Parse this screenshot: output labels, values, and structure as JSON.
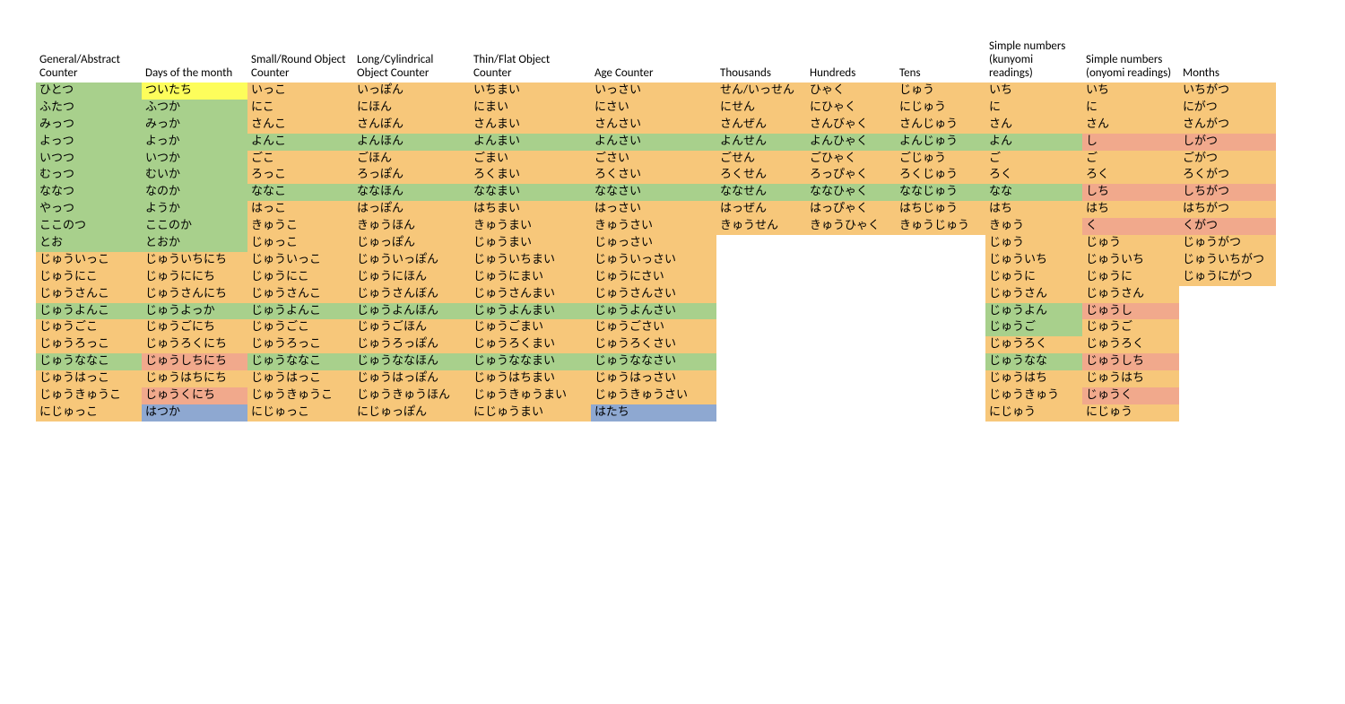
{
  "headers": [
    "General/Abstract Counter",
    "Days of the month",
    "Small/Round Object Counter",
    "Long/Cylindrical Object Counter",
    "Thin/Flat Object Counter",
    "Age Counter",
    "Thousands",
    "Hundreds",
    "Tens",
    "Simple numbers (kunyomi readings)",
    "Simple numbers (onyomi readings)",
    "Months"
  ],
  "colors": {
    "g": "c-green",
    "o": "c-orange",
    "y": "c-yellow",
    "b": "c-blue",
    "s": "c-salmon",
    "e": "c-empty"
  },
  "rows": [
    [
      {
        "t": "ひとつ",
        "c": "g"
      },
      {
        "t": "ついたち",
        "c": "y"
      },
      {
        "t": "いっこ",
        "c": "o"
      },
      {
        "t": "いっぽん",
        "c": "o"
      },
      {
        "t": "いちまい",
        "c": "o"
      },
      {
        "t": "いっさい",
        "c": "o"
      },
      {
        "t": "せん/いっせん",
        "c": "o"
      },
      {
        "t": "ひゃく",
        "c": "o"
      },
      {
        "t": "じゅう",
        "c": "o"
      },
      {
        "t": "いち",
        "c": "o"
      },
      {
        "t": "いち",
        "c": "o"
      },
      {
        "t": "いちがつ",
        "c": "o"
      }
    ],
    [
      {
        "t": "ふたつ",
        "c": "g"
      },
      {
        "t": "ふつか",
        "c": "g"
      },
      {
        "t": "にこ",
        "c": "o"
      },
      {
        "t": "にほん",
        "c": "o"
      },
      {
        "t": "にまい",
        "c": "o"
      },
      {
        "t": "にさい",
        "c": "o"
      },
      {
        "t": "にせん",
        "c": "o"
      },
      {
        "t": "にひゃく",
        "c": "o"
      },
      {
        "t": "にじゅう",
        "c": "o"
      },
      {
        "t": "に",
        "c": "o"
      },
      {
        "t": "に",
        "c": "o"
      },
      {
        "t": "にがつ",
        "c": "o"
      }
    ],
    [
      {
        "t": "みっつ",
        "c": "g"
      },
      {
        "t": "みっか",
        "c": "g"
      },
      {
        "t": "さんこ",
        "c": "o"
      },
      {
        "t": "さんぼん",
        "c": "o"
      },
      {
        "t": "さんまい",
        "c": "o"
      },
      {
        "t": "さんさい",
        "c": "o"
      },
      {
        "t": "さんぜん",
        "c": "o"
      },
      {
        "t": "さんびゃく",
        "c": "o"
      },
      {
        "t": "さんじゅう",
        "c": "o"
      },
      {
        "t": "さん",
        "c": "o"
      },
      {
        "t": "さん",
        "c": "o"
      },
      {
        "t": "さんがつ",
        "c": "o"
      }
    ],
    [
      {
        "t": "よっつ",
        "c": "g"
      },
      {
        "t": "よっか",
        "c": "g"
      },
      {
        "t": "よんこ",
        "c": "g"
      },
      {
        "t": "よんほん",
        "c": "g"
      },
      {
        "t": "よんまい",
        "c": "g"
      },
      {
        "t": "よんさい",
        "c": "g"
      },
      {
        "t": "よんせん",
        "c": "g"
      },
      {
        "t": "よんひゃく",
        "c": "g"
      },
      {
        "t": "よんじゅう",
        "c": "g"
      },
      {
        "t": "よん",
        "c": "g"
      },
      {
        "t": "し",
        "c": "s"
      },
      {
        "t": "しがつ",
        "c": "s"
      }
    ],
    [
      {
        "t": "いつつ",
        "c": "g"
      },
      {
        "t": "いつか",
        "c": "g"
      },
      {
        "t": "ごこ",
        "c": "o"
      },
      {
        "t": "ごほん",
        "c": "o"
      },
      {
        "t": "ごまい",
        "c": "o"
      },
      {
        "t": "ごさい",
        "c": "o"
      },
      {
        "t": "ごせん",
        "c": "o"
      },
      {
        "t": "ごひゃく",
        "c": "o"
      },
      {
        "t": "ごじゅう",
        "c": "o"
      },
      {
        "t": "ご",
        "c": "o"
      },
      {
        "t": "ご",
        "c": "o"
      },
      {
        "t": "ごがつ",
        "c": "o"
      }
    ],
    [
      {
        "t": "むっつ",
        "c": "g"
      },
      {
        "t": "むいか",
        "c": "g"
      },
      {
        "t": "ろっこ",
        "c": "o"
      },
      {
        "t": "ろっぽん",
        "c": "o"
      },
      {
        "t": "ろくまい",
        "c": "o"
      },
      {
        "t": "ろくさい",
        "c": "o"
      },
      {
        "t": "ろくせん",
        "c": "o"
      },
      {
        "t": "ろっぴゃく",
        "c": "o"
      },
      {
        "t": "ろくじゅう",
        "c": "o"
      },
      {
        "t": "ろく",
        "c": "o"
      },
      {
        "t": "ろく",
        "c": "o"
      },
      {
        "t": "ろくがつ",
        "c": "o"
      }
    ],
    [
      {
        "t": "ななつ",
        "c": "g"
      },
      {
        "t": "なのか",
        "c": "g"
      },
      {
        "t": "ななこ",
        "c": "g"
      },
      {
        "t": "ななほん",
        "c": "g"
      },
      {
        "t": "ななまい",
        "c": "g"
      },
      {
        "t": "ななさい",
        "c": "g"
      },
      {
        "t": "ななせん",
        "c": "g"
      },
      {
        "t": "ななひゃく",
        "c": "g"
      },
      {
        "t": "ななじゅう",
        "c": "g"
      },
      {
        "t": "なな",
        "c": "g"
      },
      {
        "t": "しち",
        "c": "s"
      },
      {
        "t": "しちがつ",
        "c": "s"
      }
    ],
    [
      {
        "t": "やっつ",
        "c": "g"
      },
      {
        "t": "ようか",
        "c": "g"
      },
      {
        "t": "はっこ",
        "c": "o"
      },
      {
        "t": "はっぽん",
        "c": "o"
      },
      {
        "t": "はちまい",
        "c": "o"
      },
      {
        "t": "はっさい",
        "c": "o"
      },
      {
        "t": "はっぜん",
        "c": "o"
      },
      {
        "t": "はっぴゃく",
        "c": "o"
      },
      {
        "t": "はちじゅう",
        "c": "o"
      },
      {
        "t": "はち",
        "c": "o"
      },
      {
        "t": "はち",
        "c": "o"
      },
      {
        "t": "はちがつ",
        "c": "o"
      }
    ],
    [
      {
        "t": "ここのつ",
        "c": "g"
      },
      {
        "t": "ここのか",
        "c": "g"
      },
      {
        "t": "きゅうこ",
        "c": "o"
      },
      {
        "t": "きゅうほん",
        "c": "o"
      },
      {
        "t": "きゅうまい",
        "c": "o"
      },
      {
        "t": "きゅうさい",
        "c": "o"
      },
      {
        "t": "きゅうせん",
        "c": "o"
      },
      {
        "t": "きゅうひゃく",
        "c": "o"
      },
      {
        "t": "きゅうじゅう",
        "c": "o"
      },
      {
        "t": "きゅう",
        "c": "o"
      },
      {
        "t": "く",
        "c": "s"
      },
      {
        "t": "くがつ",
        "c": "s"
      }
    ],
    [
      {
        "t": "とお",
        "c": "g"
      },
      {
        "t": "とおか",
        "c": "g"
      },
      {
        "t": "じゅっこ",
        "c": "o"
      },
      {
        "t": "じゅっぽん",
        "c": "o"
      },
      {
        "t": "じゅうまい",
        "c": "o"
      },
      {
        "t": "じゅっさい",
        "c": "o"
      },
      {
        "t": "",
        "c": "e"
      },
      {
        "t": "",
        "c": "e"
      },
      {
        "t": "",
        "c": "e"
      },
      {
        "t": "じゅう",
        "c": "o"
      },
      {
        "t": "じゅう",
        "c": "o"
      },
      {
        "t": "じゅうがつ",
        "c": "o"
      }
    ],
    [
      {
        "t": "じゅういっこ",
        "c": "o"
      },
      {
        "t": "じゅういちにち",
        "c": "o"
      },
      {
        "t": "じゅういっこ",
        "c": "o"
      },
      {
        "t": "じゅういっぽん",
        "c": "o"
      },
      {
        "t": "じゅういちまい",
        "c": "o"
      },
      {
        "t": "じゅういっさい",
        "c": "o"
      },
      {
        "t": "",
        "c": "e"
      },
      {
        "t": "",
        "c": "e"
      },
      {
        "t": "",
        "c": "e"
      },
      {
        "t": "じゅういち",
        "c": "o"
      },
      {
        "t": "じゅういち",
        "c": "o"
      },
      {
        "t": "じゅういちがつ",
        "c": "o"
      }
    ],
    [
      {
        "t": "じゅうにこ",
        "c": "o"
      },
      {
        "t": "じゅうににち",
        "c": "o"
      },
      {
        "t": "じゅうにこ",
        "c": "o"
      },
      {
        "t": "じゅうにほん",
        "c": "o"
      },
      {
        "t": "じゅうにまい",
        "c": "o"
      },
      {
        "t": "じゅうにさい",
        "c": "o"
      },
      {
        "t": "",
        "c": "e"
      },
      {
        "t": "",
        "c": "e"
      },
      {
        "t": "",
        "c": "e"
      },
      {
        "t": "じゅうに",
        "c": "o"
      },
      {
        "t": "じゅうに",
        "c": "o"
      },
      {
        "t": "じゅうにがつ",
        "c": "o"
      }
    ],
    [
      {
        "t": "じゅうさんこ",
        "c": "o"
      },
      {
        "t": "じゅうさんにち",
        "c": "o"
      },
      {
        "t": "じゅうさんこ",
        "c": "o"
      },
      {
        "t": "じゅうさんぼん",
        "c": "o"
      },
      {
        "t": "じゅうさんまい",
        "c": "o"
      },
      {
        "t": "じゅうさんさい",
        "c": "o"
      },
      {
        "t": "",
        "c": "e"
      },
      {
        "t": "",
        "c": "e"
      },
      {
        "t": "",
        "c": "e"
      },
      {
        "t": "じゅうさん",
        "c": "o"
      },
      {
        "t": "じゅうさん",
        "c": "o"
      },
      {
        "t": "",
        "c": "e"
      }
    ],
    [
      {
        "t": "じゅうよんこ",
        "c": "g"
      },
      {
        "t": "じゅうよっか",
        "c": "g"
      },
      {
        "t": "じゅうよんこ",
        "c": "g"
      },
      {
        "t": "じゅうよんほん",
        "c": "g"
      },
      {
        "t": "じゅうよんまい",
        "c": "g"
      },
      {
        "t": "じゅうよんさい",
        "c": "g"
      },
      {
        "t": "",
        "c": "e"
      },
      {
        "t": "",
        "c": "e"
      },
      {
        "t": "",
        "c": "e"
      },
      {
        "t": "じゅうよん",
        "c": "g"
      },
      {
        "t": "じゅうし",
        "c": "s"
      },
      {
        "t": "",
        "c": "e"
      }
    ],
    [
      {
        "t": "じゅうごこ",
        "c": "o"
      },
      {
        "t": "じゅうごにち",
        "c": "o"
      },
      {
        "t": "じゅうごこ",
        "c": "o"
      },
      {
        "t": "じゅうごほん",
        "c": "o"
      },
      {
        "t": "じゅうごまい",
        "c": "o"
      },
      {
        "t": "じゅうごさい",
        "c": "o"
      },
      {
        "t": "",
        "c": "e"
      },
      {
        "t": "",
        "c": "e"
      },
      {
        "t": "",
        "c": "e"
      },
      {
        "t": "じゅうご",
        "c": "g"
      },
      {
        "t": "じゅうご",
        "c": "o"
      },
      {
        "t": "",
        "c": "e"
      }
    ],
    [
      {
        "t": "じゅうろっこ",
        "c": "o"
      },
      {
        "t": "じゅうろくにち",
        "c": "o"
      },
      {
        "t": "じゅうろっこ",
        "c": "o"
      },
      {
        "t": "じゅうろっぽん",
        "c": "o"
      },
      {
        "t": "じゅうろくまい",
        "c": "o"
      },
      {
        "t": "じゅうろくさい",
        "c": "o"
      },
      {
        "t": "",
        "c": "e"
      },
      {
        "t": "",
        "c": "e"
      },
      {
        "t": "",
        "c": "e"
      },
      {
        "t": "じゅうろく",
        "c": "o"
      },
      {
        "t": "じゅうろく",
        "c": "o"
      },
      {
        "t": "",
        "c": "e"
      }
    ],
    [
      {
        "t": "じゅうななこ",
        "c": "g"
      },
      {
        "t": "じゅうしちにち",
        "c": "s"
      },
      {
        "t": "じゅうななこ",
        "c": "g"
      },
      {
        "t": "じゅうななほん",
        "c": "g"
      },
      {
        "t": "じゅうななまい",
        "c": "g"
      },
      {
        "t": "じゅうななさい",
        "c": "g"
      },
      {
        "t": "",
        "c": "e"
      },
      {
        "t": "",
        "c": "e"
      },
      {
        "t": "",
        "c": "e"
      },
      {
        "t": "じゅうなな",
        "c": "g"
      },
      {
        "t": "じゅうしち",
        "c": "s"
      },
      {
        "t": "",
        "c": "e"
      }
    ],
    [
      {
        "t": "じゅうはっこ",
        "c": "o"
      },
      {
        "t": "じゅうはちにち",
        "c": "o"
      },
      {
        "t": "じゅうはっこ",
        "c": "o"
      },
      {
        "t": "じゅうはっぽん",
        "c": "o"
      },
      {
        "t": "じゅうはちまい",
        "c": "o"
      },
      {
        "t": "じゅうはっさい",
        "c": "o"
      },
      {
        "t": "",
        "c": "e"
      },
      {
        "t": "",
        "c": "e"
      },
      {
        "t": "",
        "c": "e"
      },
      {
        "t": "じゅうはち",
        "c": "o"
      },
      {
        "t": "じゅうはち",
        "c": "o"
      },
      {
        "t": "",
        "c": "e"
      }
    ],
    [
      {
        "t": "じゅうきゅうこ",
        "c": "o"
      },
      {
        "t": "じゅうくにち",
        "c": "s"
      },
      {
        "t": "じゅうきゅうこ",
        "c": "o"
      },
      {
        "t": "じゅうきゅうほん",
        "c": "o"
      },
      {
        "t": "じゅうきゅうまい",
        "c": "o"
      },
      {
        "t": "じゅうきゅうさい",
        "c": "o"
      },
      {
        "t": "",
        "c": "e"
      },
      {
        "t": "",
        "c": "e"
      },
      {
        "t": "",
        "c": "e"
      },
      {
        "t": "じゅうきゅう",
        "c": "o"
      },
      {
        "t": "じゅうく",
        "c": "s"
      },
      {
        "t": "",
        "c": "e"
      }
    ],
    [
      {
        "t": "にじゅっこ",
        "c": "o"
      },
      {
        "t": "はつか",
        "c": "b"
      },
      {
        "t": "にじゅっこ",
        "c": "o"
      },
      {
        "t": "にじゅっぽん",
        "c": "o"
      },
      {
        "t": "にじゅうまい",
        "c": "o"
      },
      {
        "t": "はたち",
        "c": "b"
      },
      {
        "t": "",
        "c": "e"
      },
      {
        "t": "",
        "c": "e"
      },
      {
        "t": "",
        "c": "e"
      },
      {
        "t": "にじゅう",
        "c": "o"
      },
      {
        "t": "にじゅう",
        "c": "o"
      },
      {
        "t": "",
        "c": "e"
      }
    ]
  ]
}
